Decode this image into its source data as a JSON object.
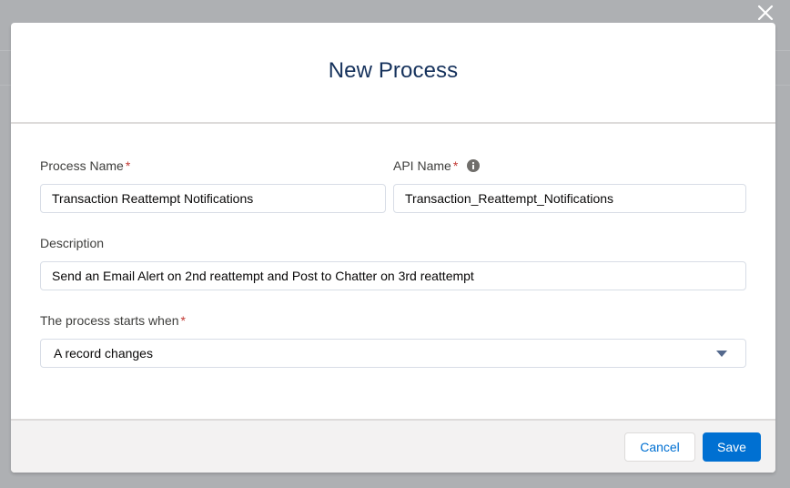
{
  "modal": {
    "title": "New Process",
    "close_icon": "close-icon"
  },
  "form": {
    "process_name": {
      "label": "Process Name",
      "required_mark": "*",
      "value": "Transaction Reattempt Notifications"
    },
    "api_name": {
      "label": "API Name",
      "required_mark": "*",
      "info_icon": "info-icon",
      "value": "Transaction_Reattempt_Notifications"
    },
    "description": {
      "label": "Description",
      "value": "Send an Email Alert on 2nd reattempt and Post to Chatter on 3rd reattempt"
    },
    "starts_when": {
      "label": "The process starts when",
      "required_mark": "*",
      "selected": "A record changes",
      "arrow_icon": "caret-down-icon"
    }
  },
  "footer": {
    "cancel_label": "Cancel",
    "save_label": "Save"
  },
  "colors": {
    "backdrop": "#aeb0b3",
    "brand": "#0070d2",
    "required": "#c23934",
    "title": "#16325c"
  }
}
